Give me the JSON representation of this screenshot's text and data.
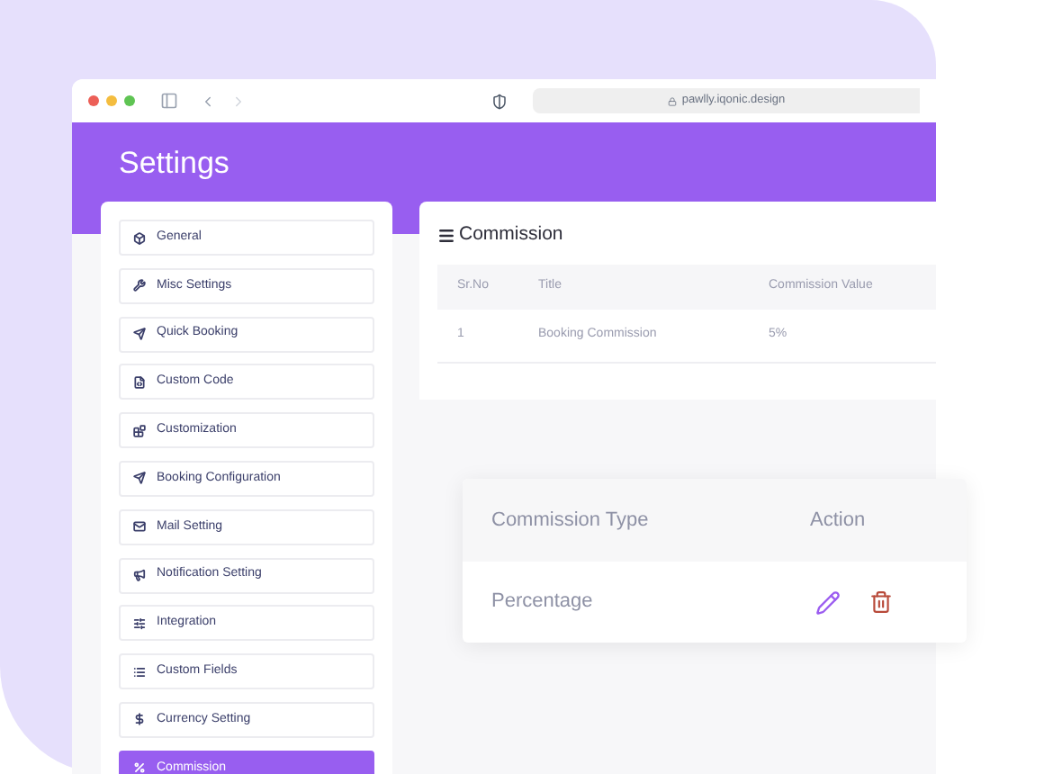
{
  "browser": {
    "url": "pawlly.iqonic.design"
  },
  "page": {
    "title": "Settings"
  },
  "sidebar": {
    "items": [
      {
        "label": "General",
        "selected": false
      },
      {
        "label": "Misc Settings",
        "selected": false
      },
      {
        "label": "Quick Booking",
        "selected": false
      },
      {
        "label": "Custom Code",
        "selected": false
      },
      {
        "label": "Customization",
        "selected": false
      },
      {
        "label": "Booking Configuration",
        "selected": false
      },
      {
        "label": "Mail Setting",
        "selected": false
      },
      {
        "label": "Notification Setting",
        "selected": false
      },
      {
        "label": "Integration",
        "selected": false
      },
      {
        "label": "Custom Fields",
        "selected": false
      },
      {
        "label": "Currency Setting",
        "selected": false
      },
      {
        "label": "Commission",
        "selected": true
      }
    ]
  },
  "commission": {
    "title": "Commission",
    "table": {
      "columns": [
        "Sr.No",
        "Title",
        "Commission Value"
      ],
      "rows": [
        [
          "1",
          "Booking Commission",
          "5%"
        ]
      ]
    }
  },
  "popup_table": {
    "columns": [
      "Commission Type",
      "Action"
    ],
    "rows": [
      {
        "type": "Percentage"
      }
    ]
  }
}
